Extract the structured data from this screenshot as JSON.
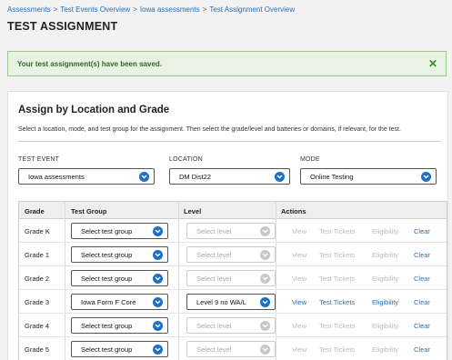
{
  "breadcrumb": {
    "items": [
      "Assessments",
      "Test Events Overview",
      "Iowa assessments",
      "Test Assignment Overview"
    ],
    "separator": ">"
  },
  "page_title": "TEST ASSIGNMENT",
  "alert": {
    "message": "Your test assignment(s) have been saved.",
    "close_glyph": "✕",
    "color": "#2e6b1f"
  },
  "panel": {
    "title": "Assign by Location and Grade",
    "description": "Select a location, mode, and test group for the assignment. Then select the grade/level and batteries or domains, if relevant, for the test."
  },
  "filters": {
    "test_event": {
      "label": "TEST EVENT",
      "value": "Iowa assessments"
    },
    "location": {
      "label": "LOCATION",
      "value": "DM Dist22"
    },
    "mode": {
      "label": "MODE",
      "value": "Online Testing"
    }
  },
  "grid": {
    "headers": {
      "grade": "Grade",
      "test_group": "Test Group",
      "level": "Level",
      "actions": "Actions"
    },
    "action_labels": {
      "view": "View",
      "tickets": "Test Tickets",
      "eligibility": "Eligibility",
      "clear": "Clear"
    },
    "rows": [
      {
        "grade": "Grade K",
        "test_group": "Select test group",
        "level": "Select level",
        "level_enabled": false,
        "actions_enabled": false
      },
      {
        "grade": "Grade 1",
        "test_group": "Select test group",
        "level": "Select level",
        "level_enabled": false,
        "actions_enabled": false
      },
      {
        "grade": "Grade 2",
        "test_group": "Select test group",
        "level": "Select level",
        "level_enabled": false,
        "actions_enabled": false
      },
      {
        "grade": "Grade 3",
        "test_group": "Iowa Form F Core",
        "level": "Level 9 no WA/L",
        "level_enabled": true,
        "actions_enabled": true
      },
      {
        "grade": "Grade 4",
        "test_group": "Select test group",
        "level": "Select level",
        "level_enabled": false,
        "actions_enabled": false
      },
      {
        "grade": "Grade 5",
        "test_group": "Select test group",
        "level": "Select level",
        "level_enabled": false,
        "actions_enabled": false
      }
    ]
  },
  "colors": {
    "accent": "#1e6fc6",
    "link": "#2a6fb8",
    "success_bg": "#e8f3e3",
    "success_border": "#9cc98b",
    "disabled": "#bbbbbb"
  },
  "icons": {
    "dropdown": "chevron-down-icon",
    "close": "close-icon"
  }
}
